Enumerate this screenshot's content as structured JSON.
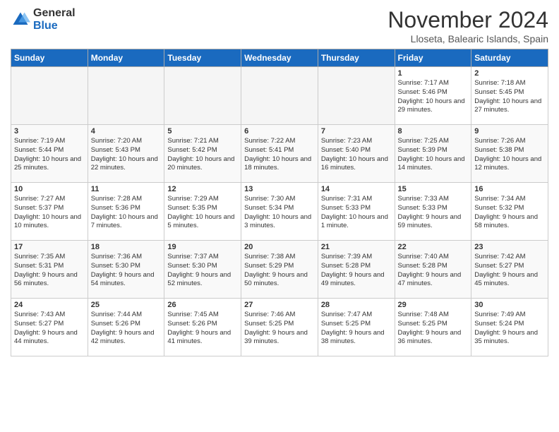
{
  "logo": {
    "general": "General",
    "blue": "Blue"
  },
  "title": "November 2024",
  "location": "Lloseta, Balearic Islands, Spain",
  "days_of_week": [
    "Sunday",
    "Monday",
    "Tuesday",
    "Wednesday",
    "Thursday",
    "Friday",
    "Saturday"
  ],
  "weeks": [
    [
      {
        "day": "",
        "info": ""
      },
      {
        "day": "",
        "info": ""
      },
      {
        "day": "",
        "info": ""
      },
      {
        "day": "",
        "info": ""
      },
      {
        "day": "",
        "info": ""
      },
      {
        "day": "1",
        "info": "Sunrise: 7:17 AM\nSunset: 5:46 PM\nDaylight: 10 hours and 29 minutes."
      },
      {
        "day": "2",
        "info": "Sunrise: 7:18 AM\nSunset: 5:45 PM\nDaylight: 10 hours and 27 minutes."
      }
    ],
    [
      {
        "day": "3",
        "info": "Sunrise: 7:19 AM\nSunset: 5:44 PM\nDaylight: 10 hours and 25 minutes."
      },
      {
        "day": "4",
        "info": "Sunrise: 7:20 AM\nSunset: 5:43 PM\nDaylight: 10 hours and 22 minutes."
      },
      {
        "day": "5",
        "info": "Sunrise: 7:21 AM\nSunset: 5:42 PM\nDaylight: 10 hours and 20 minutes."
      },
      {
        "day": "6",
        "info": "Sunrise: 7:22 AM\nSunset: 5:41 PM\nDaylight: 10 hours and 18 minutes."
      },
      {
        "day": "7",
        "info": "Sunrise: 7:23 AM\nSunset: 5:40 PM\nDaylight: 10 hours and 16 minutes."
      },
      {
        "day": "8",
        "info": "Sunrise: 7:25 AM\nSunset: 5:39 PM\nDaylight: 10 hours and 14 minutes."
      },
      {
        "day": "9",
        "info": "Sunrise: 7:26 AM\nSunset: 5:38 PM\nDaylight: 10 hours and 12 minutes."
      }
    ],
    [
      {
        "day": "10",
        "info": "Sunrise: 7:27 AM\nSunset: 5:37 PM\nDaylight: 10 hours and 10 minutes."
      },
      {
        "day": "11",
        "info": "Sunrise: 7:28 AM\nSunset: 5:36 PM\nDaylight: 10 hours and 7 minutes."
      },
      {
        "day": "12",
        "info": "Sunrise: 7:29 AM\nSunset: 5:35 PM\nDaylight: 10 hours and 5 minutes."
      },
      {
        "day": "13",
        "info": "Sunrise: 7:30 AM\nSunset: 5:34 PM\nDaylight: 10 hours and 3 minutes."
      },
      {
        "day": "14",
        "info": "Sunrise: 7:31 AM\nSunset: 5:33 PM\nDaylight: 10 hours and 1 minute."
      },
      {
        "day": "15",
        "info": "Sunrise: 7:33 AM\nSunset: 5:33 PM\nDaylight: 9 hours and 59 minutes."
      },
      {
        "day": "16",
        "info": "Sunrise: 7:34 AM\nSunset: 5:32 PM\nDaylight: 9 hours and 58 minutes."
      }
    ],
    [
      {
        "day": "17",
        "info": "Sunrise: 7:35 AM\nSunset: 5:31 PM\nDaylight: 9 hours and 56 minutes."
      },
      {
        "day": "18",
        "info": "Sunrise: 7:36 AM\nSunset: 5:30 PM\nDaylight: 9 hours and 54 minutes."
      },
      {
        "day": "19",
        "info": "Sunrise: 7:37 AM\nSunset: 5:30 PM\nDaylight: 9 hours and 52 minutes."
      },
      {
        "day": "20",
        "info": "Sunrise: 7:38 AM\nSunset: 5:29 PM\nDaylight: 9 hours and 50 minutes."
      },
      {
        "day": "21",
        "info": "Sunrise: 7:39 AM\nSunset: 5:28 PM\nDaylight: 9 hours and 49 minutes."
      },
      {
        "day": "22",
        "info": "Sunrise: 7:40 AM\nSunset: 5:28 PM\nDaylight: 9 hours and 47 minutes."
      },
      {
        "day": "23",
        "info": "Sunrise: 7:42 AM\nSunset: 5:27 PM\nDaylight: 9 hours and 45 minutes."
      }
    ],
    [
      {
        "day": "24",
        "info": "Sunrise: 7:43 AM\nSunset: 5:27 PM\nDaylight: 9 hours and 44 minutes."
      },
      {
        "day": "25",
        "info": "Sunrise: 7:44 AM\nSunset: 5:26 PM\nDaylight: 9 hours and 42 minutes."
      },
      {
        "day": "26",
        "info": "Sunrise: 7:45 AM\nSunset: 5:26 PM\nDaylight: 9 hours and 41 minutes."
      },
      {
        "day": "27",
        "info": "Sunrise: 7:46 AM\nSunset: 5:25 PM\nDaylight: 9 hours and 39 minutes."
      },
      {
        "day": "28",
        "info": "Sunrise: 7:47 AM\nSunset: 5:25 PM\nDaylight: 9 hours and 38 minutes."
      },
      {
        "day": "29",
        "info": "Sunrise: 7:48 AM\nSunset: 5:25 PM\nDaylight: 9 hours and 36 minutes."
      },
      {
        "day": "30",
        "info": "Sunrise: 7:49 AM\nSunset: 5:24 PM\nDaylight: 9 hours and 35 minutes."
      }
    ]
  ]
}
